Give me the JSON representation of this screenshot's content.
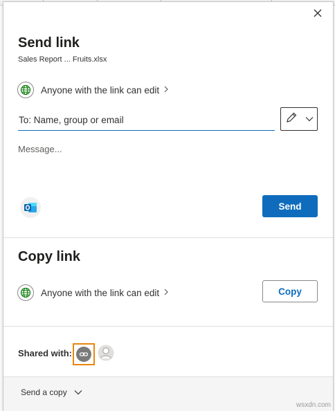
{
  "dialog": {
    "title": "Send link",
    "filename": "Sales Report ... Fruits.xlsx",
    "permission_label": "Anyone with the link can edit",
    "to_placeholder": "To: Name, group or email",
    "message_placeholder": "Message...",
    "send_label": "Send"
  },
  "copy_section": {
    "title": "Copy link",
    "permission_label": "Anyone with the link can edit",
    "copy_label": "Copy"
  },
  "shared": {
    "label": "Shared with:"
  },
  "footer": {
    "send_copy_label": "Send a copy"
  },
  "watermark": "wsxdn.com",
  "icons": {
    "close": "close-icon",
    "globe": "globe-icon",
    "chevron_right": "chevron-right-icon",
    "pencil": "pencil-icon",
    "chevron_down": "chevron-down-icon",
    "outlook": "outlook-icon",
    "link": "link-icon",
    "person": "person-icon"
  },
  "colors": {
    "accent": "#0f6cbd",
    "highlight": "#e8860f",
    "globe": "#107c10"
  }
}
